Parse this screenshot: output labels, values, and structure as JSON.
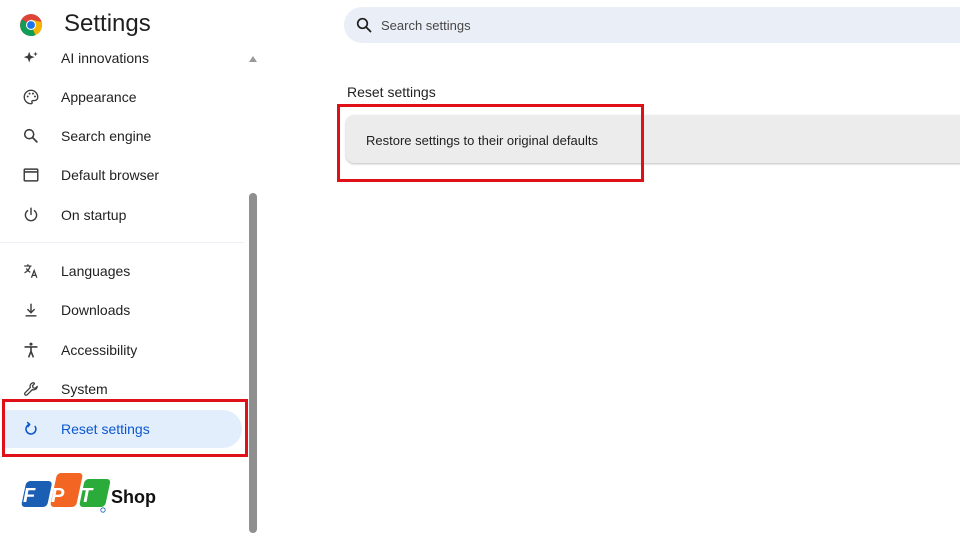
{
  "header": {
    "title": "Settings"
  },
  "search": {
    "placeholder": "Search settings"
  },
  "sidebar": {
    "items": [
      {
        "label": "AI innovations",
        "icon": "sparkle-icon"
      },
      {
        "label": "Appearance",
        "icon": "palette-icon"
      },
      {
        "label": "Search engine",
        "icon": "search-icon"
      },
      {
        "label": "Default browser",
        "icon": "browser-window-icon"
      },
      {
        "label": "On startup",
        "icon": "power-icon"
      },
      {
        "label": "Languages",
        "icon": "translate-icon"
      },
      {
        "label": "Downloads",
        "icon": "download-icon"
      },
      {
        "label": "Accessibility",
        "icon": "accessibility-icon"
      },
      {
        "label": "System",
        "icon": "wrench-icon"
      },
      {
        "label": "Reset settings",
        "icon": "reset-icon",
        "active": true
      }
    ]
  },
  "main": {
    "section_title": "Reset settings",
    "restore_label": "Restore settings to their original defaults"
  },
  "brand": {
    "logo_letters": "FPT",
    "name": "Shop"
  },
  "colors": {
    "accent": "#0b57d0",
    "active_bg": "#e3eefc",
    "highlight": "#e01018",
    "search_bg": "#eaeef6"
  }
}
